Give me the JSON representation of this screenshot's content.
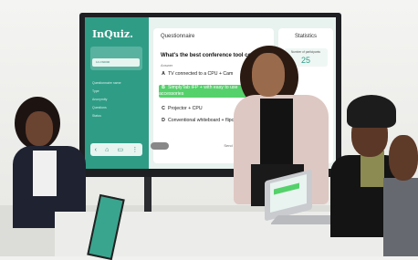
{
  "app": {
    "logo": "InQuiz.",
    "sidebar_pill": "1A CS0000",
    "meta": [
      "Questionnaire name",
      "Type",
      "Anonymity",
      "Questions",
      "Status"
    ],
    "nav_icons": [
      "back-icon",
      "home-icon",
      "pages-icon",
      "more-icon"
    ]
  },
  "question_card": {
    "header": "Questionnaire",
    "question": "What's the best conference tool combo?",
    "answer_label": "Answer",
    "options": [
      {
        "letter": "A",
        "text": "TV connected to a CPU + Cam"
      },
      {
        "letter": "B",
        "text": "SimplyTab IFP + with easy to use accessories",
        "selected": true
      },
      {
        "letter": "C",
        "text": "Projector + CPU"
      },
      {
        "letter": "D",
        "text": "Conventional whiteboard + flipchart pens"
      }
    ],
    "next_label": "Send"
  },
  "statistics": {
    "title": "Statistics",
    "stat_label": "Number of participants",
    "stat_value": "25"
  },
  "colors": {
    "brand": "#2f9c86",
    "selected": "#55d16b"
  }
}
